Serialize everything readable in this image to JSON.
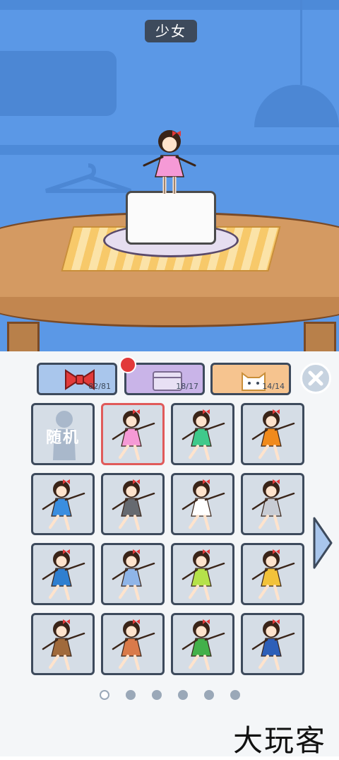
{
  "header": {
    "title": "少女"
  },
  "tabs": [
    {
      "name": "bow",
      "count": "82/81",
      "color": "#a9c6ec",
      "active": true
    },
    {
      "name": "box",
      "count": "18/17",
      "color": "#c9b4e8",
      "active": false
    },
    {
      "name": "cat",
      "count": "14/14",
      "color": "#f6c48f",
      "active": false
    }
  ],
  "grid": {
    "random_label": "随机",
    "items": [
      {
        "dress": "#f59ad6"
      },
      {
        "dress": "#3fc98b"
      },
      {
        "dress": "#f08a1c"
      },
      {
        "dress": "#3a8ee0"
      },
      {
        "dress": "#666a70"
      },
      {
        "dress": "#ffffff"
      },
      {
        "dress": "#c8ccd4"
      },
      {
        "dress": "#2f7fd0"
      },
      {
        "dress": "#8fb5e8"
      },
      {
        "dress": "#b5e24a"
      },
      {
        "dress": "#f2c23a"
      },
      {
        "dress": "#a06a3c"
      },
      {
        "dress": "#d97a4a"
      },
      {
        "dress": "#43b04a"
      },
      {
        "dress": "#2d5fb8"
      }
    ]
  },
  "pagination": {
    "pages": 6,
    "current": 1
  },
  "watermark": "大玩客",
  "colors": {
    "accent": "#3d4a5c",
    "selected": "#e05a5a",
    "sky": "#5b98e6"
  }
}
